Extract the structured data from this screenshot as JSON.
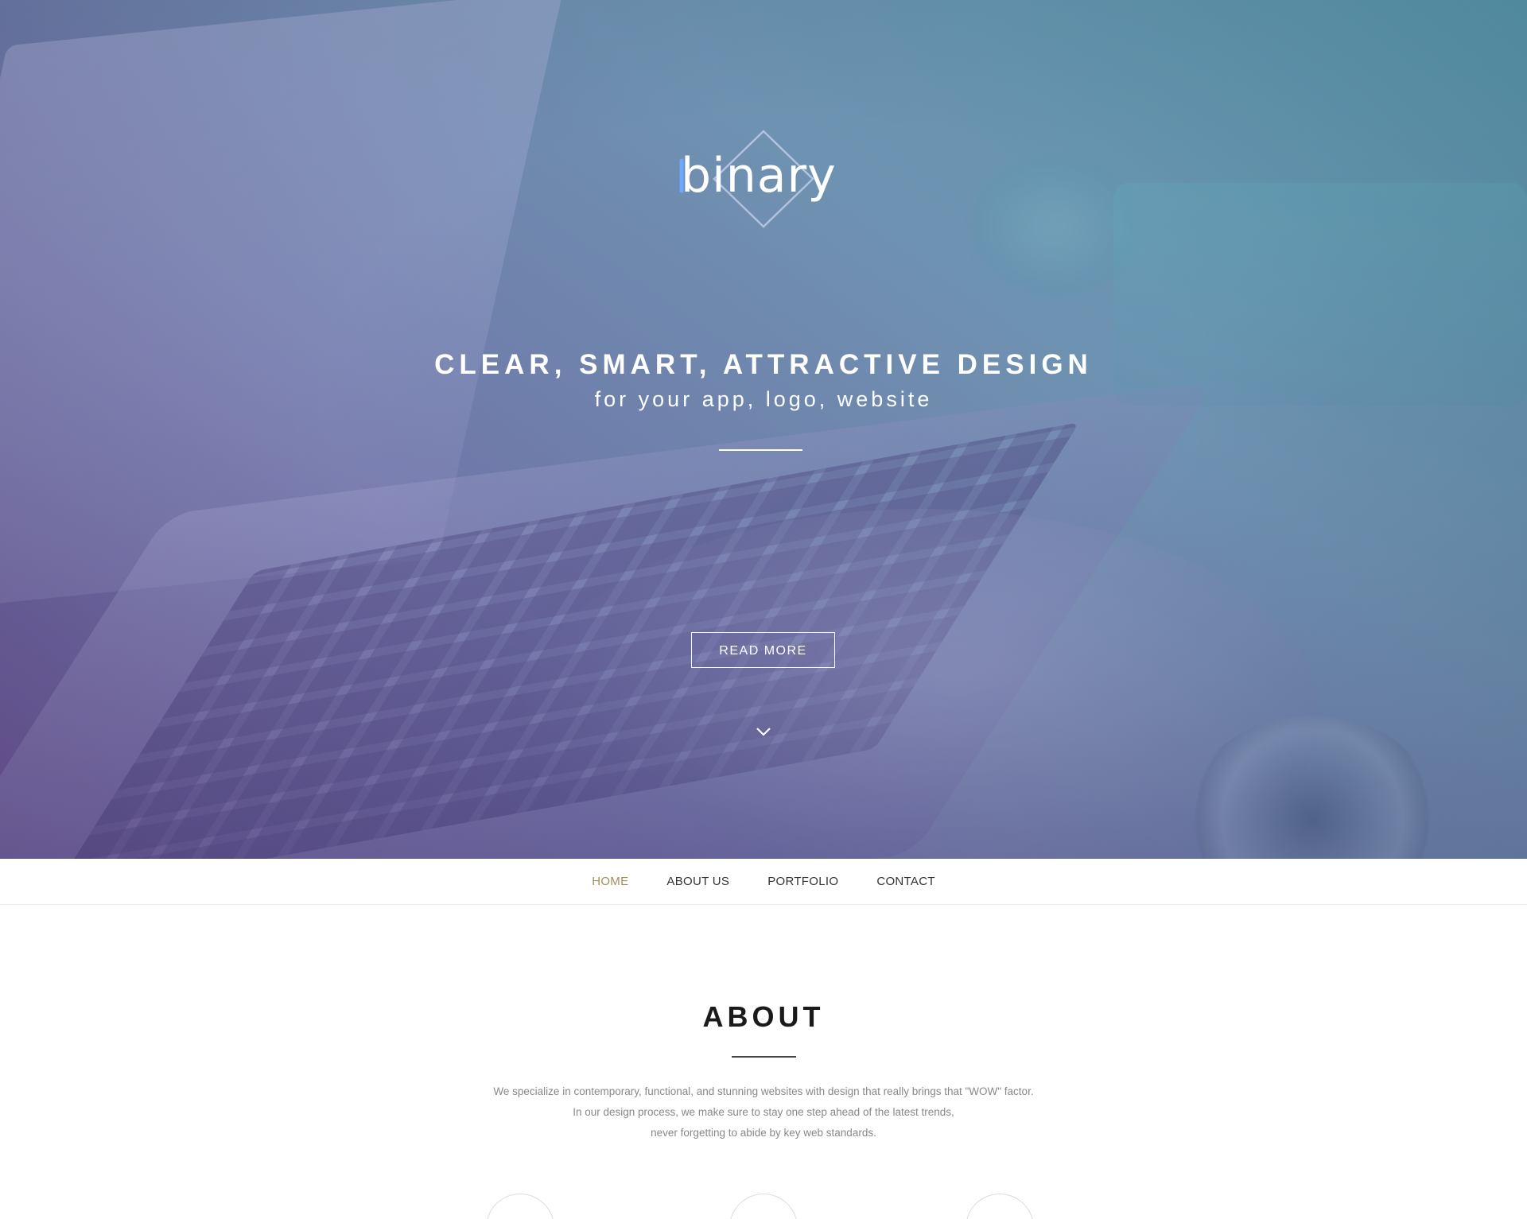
{
  "brand": {
    "logo_text": "binary"
  },
  "hero": {
    "headline": "CLEAR, SMART, ATTRACTIVE DESIGN",
    "subheadline": "for your app, logo, website",
    "read_more_label": "READ MORE",
    "scroll_icon": "chevron-down-icon"
  },
  "nav": {
    "items": [
      {
        "label": "HOME",
        "active": true
      },
      {
        "label": "ABOUT US",
        "active": false
      },
      {
        "label": "PORTFOLIO",
        "active": false
      },
      {
        "label": "CONTACT",
        "active": false
      }
    ],
    "active_color": "#a38c5c"
  },
  "about": {
    "title": "ABOUT",
    "lines": [
      "We specialize in contemporary, functional, and stunning websites with design that really brings that \"WOW\" factor.",
      "In our design process, we make sure to stay one step ahead of the latest trends,",
      "never forgetting to abide by key web standards."
    ]
  },
  "colors": {
    "hero_gradient_start": "#5f468c",
    "hero_gradient_end": "#3c8ca0",
    "logo_accent": "#6fa8ff"
  }
}
